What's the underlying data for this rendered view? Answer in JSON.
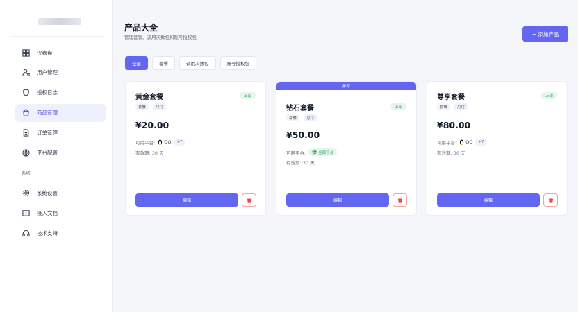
{
  "sidebar": {
    "items": [
      {
        "label": "仪表盘",
        "icon": "grid-icon"
      },
      {
        "label": "用户管理",
        "icon": "user-icon"
      },
      {
        "label": "授权日志",
        "icon": "shield-icon"
      },
      {
        "label": "商品管理",
        "icon": "bag-icon"
      },
      {
        "label": "订单管理",
        "icon": "file-icon"
      },
      {
        "label": "平台配置",
        "icon": "globe-icon"
      }
    ],
    "section_label": "系统",
    "system_items": [
      {
        "label": "系统设置",
        "icon": "gear-icon"
      },
      {
        "label": "接入文档",
        "icon": "book-icon"
      },
      {
        "label": "技术支持",
        "icon": "headset-icon"
      }
    ]
  },
  "header": {
    "title": "产品大全",
    "subtitle": "管理套餐、调用次数包和账号授权包",
    "add_button": "+ 添加产品"
  },
  "tabs": [
    "全部",
    "套餐",
    "调用次数包",
    "账号授权包"
  ],
  "cards": [
    {
      "name": "黄金套餐",
      "status": "上架",
      "tags": [
        "套餐",
        "月付"
      ],
      "price": "¥20.00",
      "platform_label": "可用平台:",
      "platform": "QQ",
      "platform_more": "+7",
      "validity": "有效期: 30 天",
      "edit_label": "编辑"
    },
    {
      "recommend": "推荐",
      "name": "钻石套餐",
      "status": "上架",
      "tags": [
        "套餐",
        "月付"
      ],
      "price": "¥50.00",
      "platform_label": "可用平台:",
      "platform_all": "全部平台",
      "validity": "有效期: 30 天",
      "edit_label": "编辑"
    },
    {
      "name": "尊享套餐",
      "status": "上架",
      "tags": [
        "套餐",
        "月付"
      ],
      "price": "¥80.00",
      "platform_label": "可用平台:",
      "platform": "QQ",
      "platform_more": "+7",
      "validity": "有效期: 30 天",
      "edit_label": "编辑"
    }
  ],
  "colors": {
    "accent": "#6366f1",
    "success": "#22a35a",
    "danger": "#ef4444"
  }
}
